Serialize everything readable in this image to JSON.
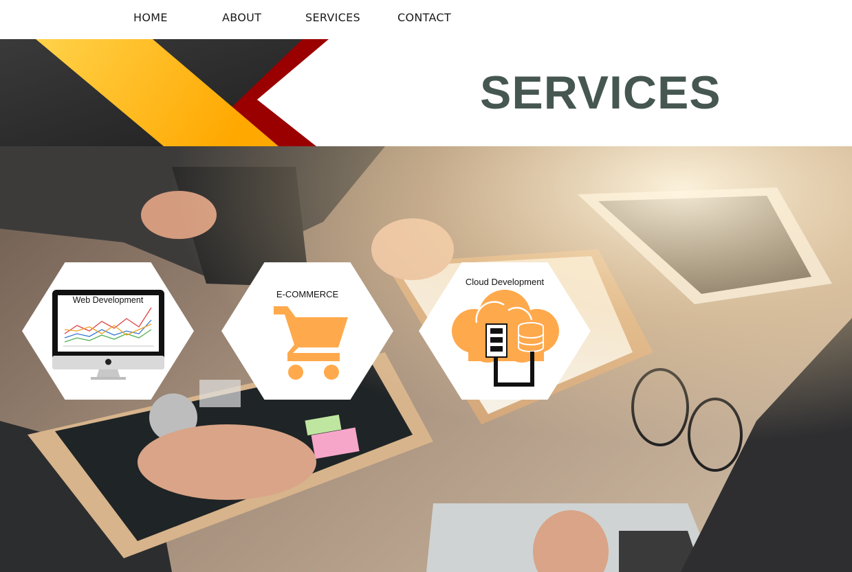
{
  "nav": {
    "items": [
      {
        "label": "HOME"
      },
      {
        "label": "ABOUT"
      },
      {
        "label": "SERVICES"
      },
      {
        "label": "CONTACT"
      }
    ]
  },
  "banner": {
    "title": "SERVICES",
    "colors": {
      "title": "#455750",
      "gold": "#FFB400",
      "red": "#9A0000",
      "dark": "#2b2b2b"
    }
  },
  "services": [
    {
      "label": "Web Development",
      "icon": "monitor-chart-icon"
    },
    {
      "label": "E-COMMERCE",
      "icon": "shopping-cart-icon"
    },
    {
      "label": "Cloud Development",
      "icon": "cloud-database-icon"
    }
  ],
  "accent_color": "#FFA94D"
}
